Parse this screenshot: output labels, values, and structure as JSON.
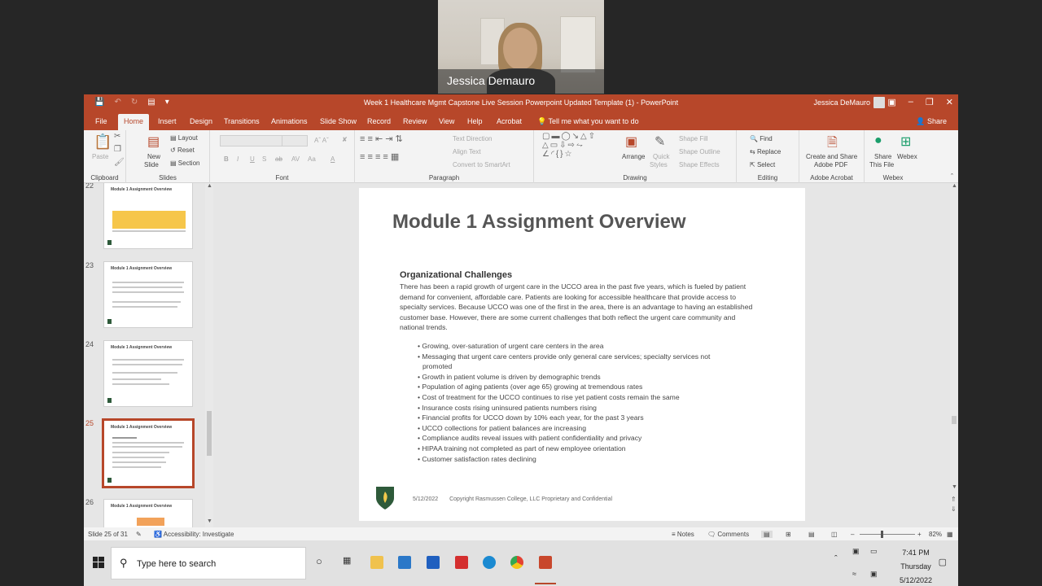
{
  "webcam": {
    "name": "Jessica Demauro"
  },
  "window": {
    "title": "Week 1 Healthcare Mgmt Capstone Live Session Powerpoint Updated Template (1)  -  PowerPoint",
    "user": "Jessica DeMauro"
  },
  "tabs": [
    "File",
    "Home",
    "Insert",
    "Design",
    "Transitions",
    "Animations",
    "Slide Show",
    "Record",
    "Review",
    "View",
    "Help",
    "Acrobat"
  ],
  "active_tab": "Home",
  "tell_me": "Tell me what you want to do",
  "share": "Share",
  "ribbon": {
    "clipboard": {
      "paste": "Paste",
      "label": "Clipboard"
    },
    "slides": {
      "new_slide_1": "New",
      "new_slide_2": "Slide",
      "layout": "Layout",
      "reset": "Reset",
      "section": "Section",
      "label": "Slides"
    },
    "font": {
      "bold": "B",
      "italic": "I",
      "underline": "U",
      "strike": "S",
      "ab": "ab",
      "av": "AV",
      "aa": "Aa",
      "font_color": "A",
      "label": "Font"
    },
    "paragraph": {
      "text_direction": "Text Direction",
      "align_text": "Align Text",
      "smartart": "Convert to SmartArt",
      "label": "Paragraph"
    },
    "drawing": {
      "arrange": "Arrange",
      "quick_1": "Quick",
      "quick_2": "Styles",
      "shape_fill": "Shape Fill",
      "shape_outline": "Shape Outline",
      "shape_effects": "Shape Effects",
      "label": "Drawing"
    },
    "editing": {
      "find": "Find",
      "replace": "Replace",
      "select": "Select",
      "label": "Editing"
    },
    "acrobat": {
      "line1": "Create and Share",
      "line2": "Adobe PDF",
      "label": "Adobe Acrobat"
    },
    "webex": {
      "share_1": "Share",
      "share_2": "This File",
      "webex": "Webex",
      "label": "Webex"
    }
  },
  "thumbnails": [
    {
      "num": "22",
      "title": "Module 1 Assignment Overview"
    },
    {
      "num": "23",
      "title": "Module 1 Assignment Overview"
    },
    {
      "num": "24",
      "title": "Module 1 Assignment Overview"
    },
    {
      "num": "25",
      "title": "Module 1 Assignment Overview"
    },
    {
      "num": "26",
      "title": "Module 1 Assignment Overview"
    }
  ],
  "slide": {
    "title": "Module 1 Assignment Overview",
    "subtitle": "Organizational Challenges",
    "paragraph": "There has been a rapid growth of urgent care in the UCCO area in the past five years, which is fueled by patient demand for convenient, affordable care. Patients are looking for accessible healthcare that provide access to specialty services. Because UCCO was one of the first in the area, there is an advantage to having an established customer base. However, there are some current challenges that both reflect the urgent care community and national trends.",
    "bullets": [
      "Growing, over-saturation of urgent care centers in the area",
      "Messaging that urgent care centers provide only general care services; specialty services not promoted",
      "Growth in patient volume is driven by demographic trends",
      "Population of aging patients (over age 65) growing at tremendous rates",
      "Cost of treatment for the UCCO continues to rise yet patient costs remain the same",
      "Insurance costs rising uninsured patients numbers rising",
      "Financial profits for UCCO down by 10% each year, for the past 3 years",
      "UCCO collections for patient balances are increasing",
      "Compliance audits reveal issues with patient confidentiality and privacy",
      "HIPAA training not completed as part of new employee orientation",
      "Customer satisfaction rates declining"
    ],
    "footer_date": "5/12/2022",
    "footer_text": "Copyright Rasmussen College, LLC Proprietary and Confidential"
  },
  "status": {
    "slide_count": "Slide 25 of 31",
    "accessibility": "Accessibility: Investigate",
    "notes": "Notes",
    "comments": "Comments",
    "zoom": "82%"
  },
  "taskbar": {
    "search_placeholder": "Type here to search",
    "time": "7:41 PM",
    "day": "Thursday",
    "date": "5/12/2022"
  },
  "colors": {
    "accent": "#b7472a",
    "shield": "#2e5a3a"
  }
}
